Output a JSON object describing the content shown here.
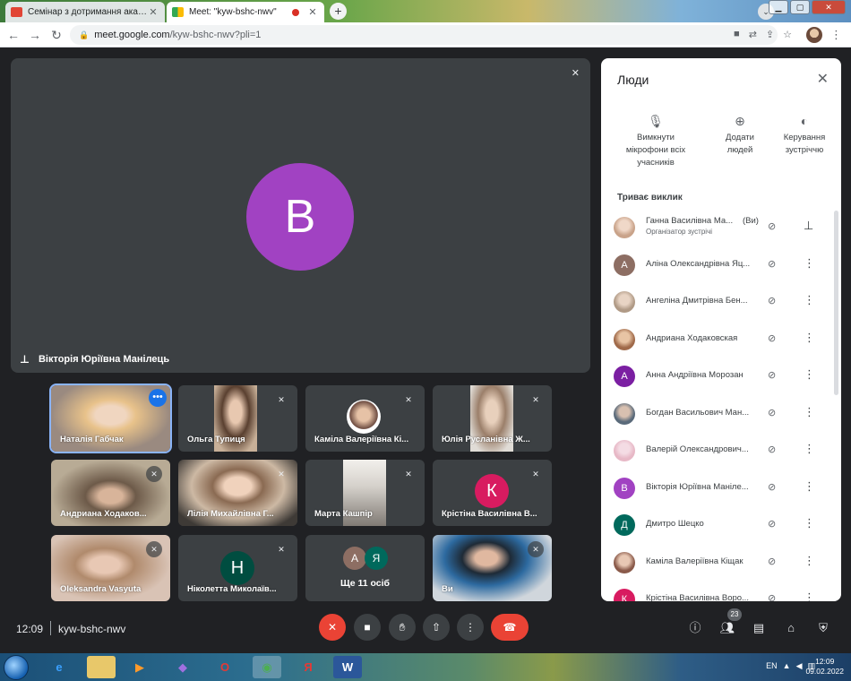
{
  "browser": {
    "tabs": [
      {
        "title": "Семінар з дотримання академічн",
        "favicon_color": "#ea4335",
        "active": false
      },
      {
        "title": "Meet: \"kyw-bshc-nwv\"",
        "favicon_color": "#34a853",
        "active": true,
        "recording": true
      }
    ],
    "new_tab": "+",
    "address": {
      "host": "meet.google.com",
      "path": "/kyw-bshc-nwv?pli=1"
    }
  },
  "main_tile": {
    "avatar_letter": "В",
    "avatar_color": "#a142c2",
    "speaker_name": "Вікторія Юріївна Манілець"
  },
  "tiles": [
    {
      "name": "Наталія Габчак",
      "kind": "photo",
      "colors": [
        "#b7a9a0",
        "#e6cbb5"
      ],
      "speaking": true
    },
    {
      "name": "Ольга Тупиця",
      "kind": "photo",
      "colors": [
        "#8a7560",
        "#d9c2a8"
      ]
    },
    {
      "name": "Каміла Валеріївна Кі...",
      "kind": "round",
      "colors": [
        "#ffffff",
        "#6d4c41"
      ]
    },
    {
      "name": "Юлія Русланівна Ж...",
      "kind": "photo",
      "colors": [
        "#d8d2c8",
        "#9b7f6a"
      ]
    },
    {
      "name": "Андриана Ходаков...",
      "kind": "photo",
      "colors": [
        "#b8ab95",
        "#6d5a49"
      ]
    },
    {
      "name": "Лілія Михайлівна Г...",
      "kind": "photo",
      "colors": [
        "#cdb9a4",
        "#3e3a36"
      ]
    },
    {
      "name": "Марта Кашпір",
      "kind": "photo",
      "colors": [
        "#d5d1cb",
        "#807a74"
      ]
    },
    {
      "name": "Крістіна Василівна В...",
      "kind": "avatar",
      "letter": "К",
      "colors": [
        "#d81b60"
      ]
    },
    {
      "name": "Oleksandra Vasyuta",
      "kind": "photo",
      "colors": [
        "#d9c3b5",
        "#b08a6c"
      ]
    },
    {
      "name": "Ніколетта Миколаїв...",
      "kind": "avatar",
      "letter": "Н",
      "colors": [
        "#004d40"
      ]
    },
    {
      "name": "Ще 11 осіб",
      "kind": "more",
      "letters": [
        "А",
        "Я"
      ],
      "colors": [
        "#8d6e63",
        "#00695c"
      ]
    },
    {
      "name": "Ви",
      "kind": "photo",
      "colors": [
        "#d0d6dc",
        "#2a3a4a"
      ]
    }
  ],
  "people_panel": {
    "title": "Люди",
    "actions": [
      {
        "icon": "mic-off-icon",
        "label": "Вимкнути мікрофони всіх учасників"
      },
      {
        "icon": "add-person-icon",
        "label": "Додати людей"
      },
      {
        "icon": "toggle-icon",
        "label": "Керування зустріччю"
      }
    ],
    "section_label": "Триває виклик",
    "participants": [
      {
        "name": "Ганна Василівна Ма...",
        "you": "(Ви)",
        "role": "Організатор зустрічі",
        "avatar_color": "#c9a38a",
        "photo": true
      },
      {
        "name": "Аліна Олександрівна Яц...",
        "letter": "А",
        "avatar_color": "#8d6e63"
      },
      {
        "name": "Ангеліна Дмитрівна Бен...",
        "avatar_color": "#b09a86",
        "photo": true
      },
      {
        "name": "Андриана Ходаковская",
        "avatar_color": "#a06a4a",
        "photo": true
      },
      {
        "name": "Анна Андріївна Морозан",
        "letter": "А",
        "avatar_color": "#7b1fa2"
      },
      {
        "name": "Богдан Васильович Ман...",
        "avatar_color": "#5a6a7a",
        "photo": true
      },
      {
        "name": "Валерій Олександрович...",
        "avatar_color": "#e7b8c6",
        "photo": true
      },
      {
        "name": "Вікторія Юріївна Маніле...",
        "letter": "В",
        "avatar_color": "#a142c2"
      },
      {
        "name": "Дмитро Шецко",
        "letter": "Д",
        "avatar_color": "#00695c"
      },
      {
        "name": "Каміла Валеріївна Кіщак",
        "avatar_color": "#8a5a4a",
        "photo": true
      },
      {
        "name": "Крістіна Василівна Воро...",
        "letter": "К",
        "avatar_color": "#d81b60"
      }
    ]
  },
  "controls": {
    "time": "12:09",
    "meeting_code": "kyw-bshc-nwv",
    "people_count": "23"
  },
  "taskbar": {
    "lang": "EN",
    "clock_time": "12:09",
    "clock_date": "09.02.2022"
  }
}
